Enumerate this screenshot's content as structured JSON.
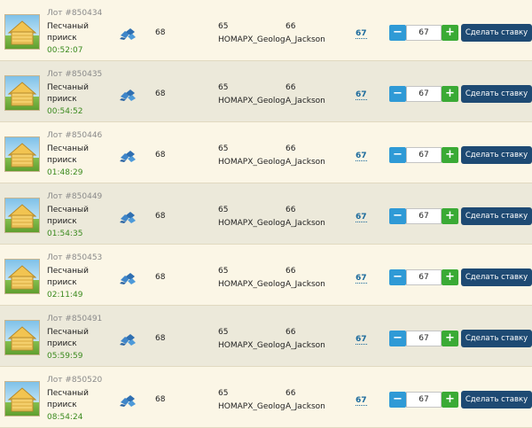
{
  "lots": [
    {
      "lot_label": "Лот #850434",
      "name_line1": "Песчаный",
      "name_line2": "прииск",
      "timer": "00:52:07",
      "resource_icon": "ore-pile-icon",
      "quantity": "68",
      "col1_top": "65",
      "col1_bottom": "HOMAPX_Geolog",
      "col2_top": "66",
      "col2_bottom": "A_Jackson",
      "price": "67",
      "bid_value": "67",
      "minus_label": "−",
      "plus_label": "+",
      "bid_button_label": "Сделать ставку"
    },
    {
      "lot_label": "Лот #850435",
      "name_line1": "Песчаный",
      "name_line2": "прииск",
      "timer": "00:54:52",
      "resource_icon": "ore-pile-icon",
      "quantity": "68",
      "col1_top": "65",
      "col1_bottom": "HOMAPX_Geolog",
      "col2_top": "66",
      "col2_bottom": "A_Jackson",
      "price": "67",
      "bid_value": "67",
      "minus_label": "−",
      "plus_label": "+",
      "bid_button_label": "Сделать ставку"
    },
    {
      "lot_label": "Лот #850446",
      "name_line1": "Песчаный",
      "name_line2": "прииск",
      "timer": "01:48:29",
      "resource_icon": "ore-pile-icon",
      "quantity": "68",
      "col1_top": "65",
      "col1_bottom": "HOMAPX_Geolog",
      "col2_top": "66",
      "col2_bottom": "A_Jackson",
      "price": "67",
      "bid_value": "67",
      "minus_label": "−",
      "plus_label": "+",
      "bid_button_label": "Сделать ставку"
    },
    {
      "lot_label": "Лот #850449",
      "name_line1": "Песчаный",
      "name_line2": "прииск",
      "timer": "01:54:35",
      "resource_icon": "ore-pile-icon",
      "quantity": "68",
      "col1_top": "65",
      "col1_bottom": "HOMAPX_Geolog",
      "col2_top": "66",
      "col2_bottom": "A_Jackson",
      "price": "67",
      "bid_value": "67",
      "minus_label": "−",
      "plus_label": "+",
      "bid_button_label": "Сделать ставку"
    },
    {
      "lot_label": "Лот #850453",
      "name_line1": "Песчаный",
      "name_line2": "прииск",
      "timer": "02:11:49",
      "resource_icon": "ore-pile-icon",
      "quantity": "68",
      "col1_top": "65",
      "col1_bottom": "HOMAPX_Geolog",
      "col2_top": "66",
      "col2_bottom": "A_Jackson",
      "price": "67",
      "bid_value": "67",
      "minus_label": "−",
      "plus_label": "+",
      "bid_button_label": "Сделать ставку"
    },
    {
      "lot_label": "Лот #850491",
      "name_line1": "Песчаный",
      "name_line2": "прииск",
      "timer": "05:59:59",
      "resource_icon": "ore-pile-icon",
      "quantity": "68",
      "col1_top": "65",
      "col1_bottom": "HOMAPX_Geolog",
      "col2_top": "66",
      "col2_bottom": "A_Jackson",
      "price": "67",
      "bid_value": "67",
      "minus_label": "−",
      "plus_label": "+",
      "bid_button_label": "Сделать ставку"
    },
    {
      "lot_label": "Лот #850520",
      "name_line1": "Песчаный",
      "name_line2": "прииск",
      "timer": "08:54:24",
      "resource_icon": "ore-pile-icon",
      "quantity": "68",
      "col1_top": "65",
      "col1_bottom": "HOMAPX_Geolog",
      "col2_top": "66",
      "col2_bottom": "A_Jackson",
      "price": "67",
      "bid_value": "67",
      "minus_label": "−",
      "plus_label": "+",
      "bid_button_label": "Сделать ставку"
    }
  ],
  "colors": {
    "row_light": "#fbf6e6",
    "row_dark": "#ece9da",
    "timer_green": "#3b8a1e",
    "price_blue": "#1b6a9c",
    "minus_blue": "#2f9ad6",
    "plus_green": "#3aaa35",
    "bid_button_navy": "#1e4a73"
  }
}
